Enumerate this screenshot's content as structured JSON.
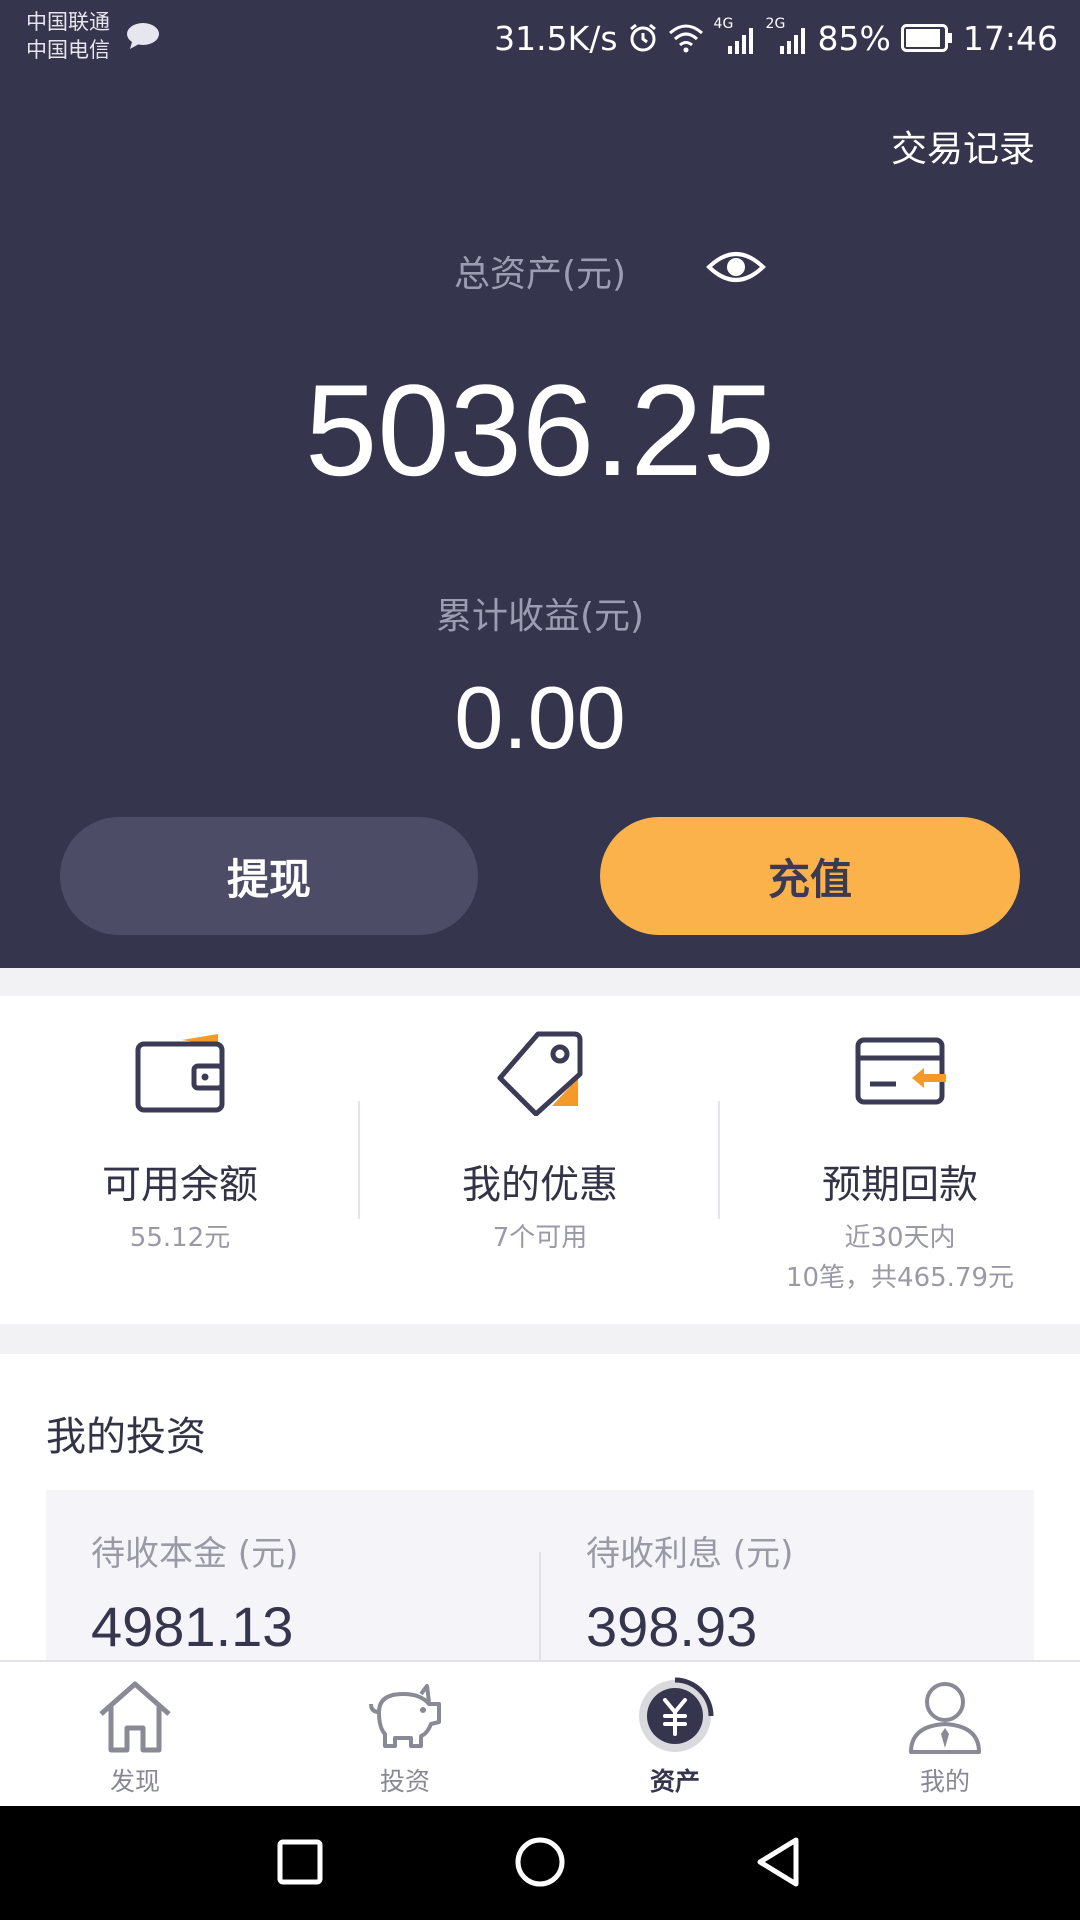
{
  "status_bar": {
    "carrier_1": "中国联通",
    "carrier_2": "中国电信",
    "net_speed": "31.5K/s",
    "signal_1": "4G",
    "signal_2": "2G",
    "battery": "85%",
    "time": "17:46"
  },
  "header": {
    "transactions_link": "交易记录"
  },
  "summary": {
    "total_label": "总资产(元)",
    "total_value": "5036.25",
    "cumulative_label": "累计收益(元)",
    "cumulative_value": "0.00"
  },
  "actions": {
    "withdraw": "提现",
    "recharge": "充值"
  },
  "quick": [
    {
      "title": "可用余额",
      "sub": "55.12元",
      "icon": "wallet-icon"
    },
    {
      "title": "我的优惠",
      "sub": "7个可用",
      "icon": "tag-icon"
    },
    {
      "title": "预期回款",
      "sub": "近30天内",
      "sub2": "10笔，共465.79元",
      "icon": "card-icon"
    }
  ],
  "investments": {
    "title": "我的投资",
    "principal_label": "待收本金 (元)",
    "principal_value": "4981.13",
    "interest_label": "待收利息 (元)",
    "interest_value": "398.93"
  },
  "tabs": [
    {
      "label": "发现",
      "icon": "home-icon"
    },
    {
      "label": "投资",
      "icon": "piggy-bank-icon"
    },
    {
      "label": "资产",
      "icon": "yuan-coin-icon",
      "active": true
    },
    {
      "label": "我的",
      "icon": "user-icon"
    }
  ],
  "colors": {
    "header_bg": "#35354d",
    "accent": "#fbb24b",
    "orange_icon": "#f39a2a"
  }
}
